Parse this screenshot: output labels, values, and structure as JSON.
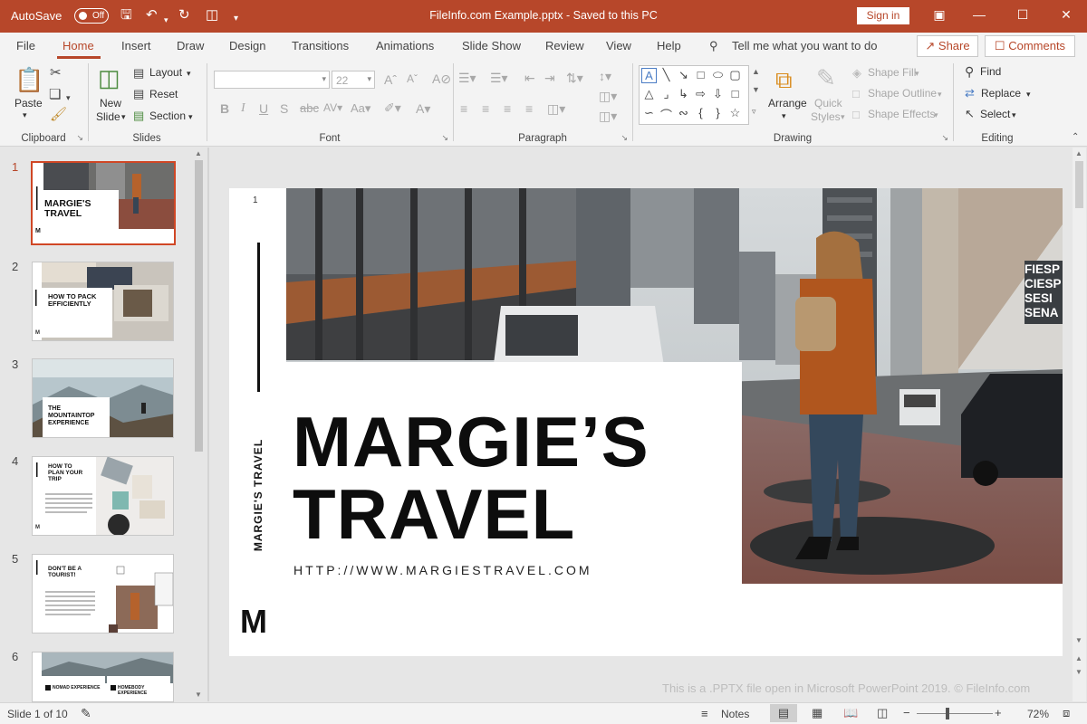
{
  "titlebar": {
    "autosave": "AutoSave",
    "toggle": "Off",
    "title": "FileInfo.com Example.pptx - Saved to this PC",
    "signin": "Sign in"
  },
  "menu": {
    "tabs": [
      "File",
      "Home",
      "Insert",
      "Draw",
      "Design",
      "Transitions",
      "Animations",
      "Slide Show",
      "Review",
      "View",
      "Help"
    ],
    "tellme": "Tell me what you want to do",
    "share": "Share",
    "comments": "Comments"
  },
  "ribbon": {
    "clipboard": {
      "label": "Clipboard",
      "paste": "Paste"
    },
    "slides": {
      "label": "Slides",
      "new_slide_1": "New",
      "new_slide_2": "Slide",
      "layout": "Layout",
      "reset": "Reset",
      "section": "Section"
    },
    "font": {
      "label": "Font",
      "size": "22"
    },
    "paragraph": {
      "label": "Paragraph"
    },
    "drawing": {
      "label": "Drawing",
      "arrange": "Arrange",
      "quick_styles_1": "Quick",
      "quick_styles_2": "Styles",
      "shape_fill": "Shape Fill",
      "shape_outline": "Shape Outline",
      "shape_effects": "Shape Effects"
    },
    "editing": {
      "label": "Editing",
      "find": "Find",
      "replace": "Replace",
      "select": "Select"
    }
  },
  "thumbnails": [
    {
      "num": "1",
      "title_1": "MARGIE'S",
      "title_2": "TRAVEL"
    },
    {
      "num": "2",
      "title": "HOW TO PACK EFFICIENTLY"
    },
    {
      "num": "3",
      "title": "THE MOUNTAINTOP EXPERIENCE"
    },
    {
      "num": "4",
      "title": "HOW TO PLAN YOUR TRIP"
    },
    {
      "num": "5",
      "title": "DON'T BE A TOURIST!"
    },
    {
      "num": "6",
      "left": "NOMAD EXPERIENCE",
      "right": "HOMEBODY EXPERIENCE"
    }
  ],
  "slide": {
    "num": "1",
    "vertical": "MARGIE'S TRAVEL",
    "title_1": "MARGIE’S",
    "title_2": "TRAVEL",
    "url": "HTTP://WWW.MARGIESTRAVEL.COM",
    "logo": "M",
    "sign_1": "FIESP",
    "sign_2": "CIESP",
    "sign_3": "SESI",
    "sign_4": "SENA"
  },
  "watermark": "This is a .PPTX file open in Microsoft PowerPoint 2019. © FileInfo.com",
  "status": {
    "slide": "Slide 1 of 10",
    "notes": "Notes",
    "zoom": "72%"
  },
  "colors": {
    "accent": "#b7472a",
    "titlebar": "#b7472a",
    "selection": "#d04725"
  },
  "icons": [
    "save-icon",
    "undo-icon",
    "redo-icon",
    "present-icon",
    "minimize-icon",
    "maximize-icon",
    "close-icon",
    "search-icon",
    "paste-icon",
    "cut-icon",
    "copy-icon",
    "format-painter-icon",
    "new-slide-icon",
    "bold-icon",
    "italic-icon",
    "underline-icon",
    "find-icon",
    "replace-icon",
    "select-icon"
  ]
}
